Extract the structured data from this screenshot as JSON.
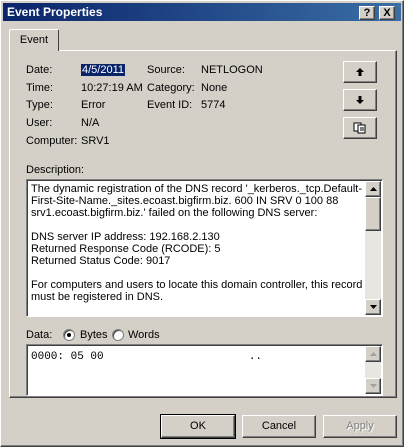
{
  "window": {
    "title": "Event Properties",
    "help_label": "?",
    "close_label": "X"
  },
  "tabs": [
    {
      "label": "Event"
    }
  ],
  "event": {
    "date_label": "Date:",
    "date": "4/5/2011",
    "source_label": "Source:",
    "source": "NETLOGON",
    "time_label": "Time:",
    "time": "10:27:19 AM",
    "category_label": "Category:",
    "category": "None",
    "type_label": "Type:",
    "type": "Error",
    "event_id_label": "Event ID:",
    "event_id": "5774",
    "user_label": "User:",
    "user": "N/A",
    "computer_label": "Computer:",
    "computer": "SRV1"
  },
  "description": {
    "label": "Description:",
    "lines": [
      "The dynamic registration of the DNS record '_kerberos._tcp.Default-",
      "First-Site-Name._sites.ecoast.bigfirm.biz. 600 IN SRV 0 100 88",
      "srv1.ecoast.bigfirm.biz.' failed on the following DNS server:",
      "",
      "DNS server IP address: 192.168.2.130",
      "Returned Response Code (RCODE): 5",
      "Returned Status Code: 9017",
      "",
      "For computers and users to locate this domain controller, this record",
      "must be registered in DNS."
    ]
  },
  "data": {
    "label": "Data:",
    "bytes_label": "Bytes",
    "words_label": "Words",
    "selected": "bytes",
    "hex_line": "0000: 05 00                      .."
  },
  "buttons": {
    "ok": "OK",
    "cancel": "Cancel",
    "apply": "Apply"
  }
}
